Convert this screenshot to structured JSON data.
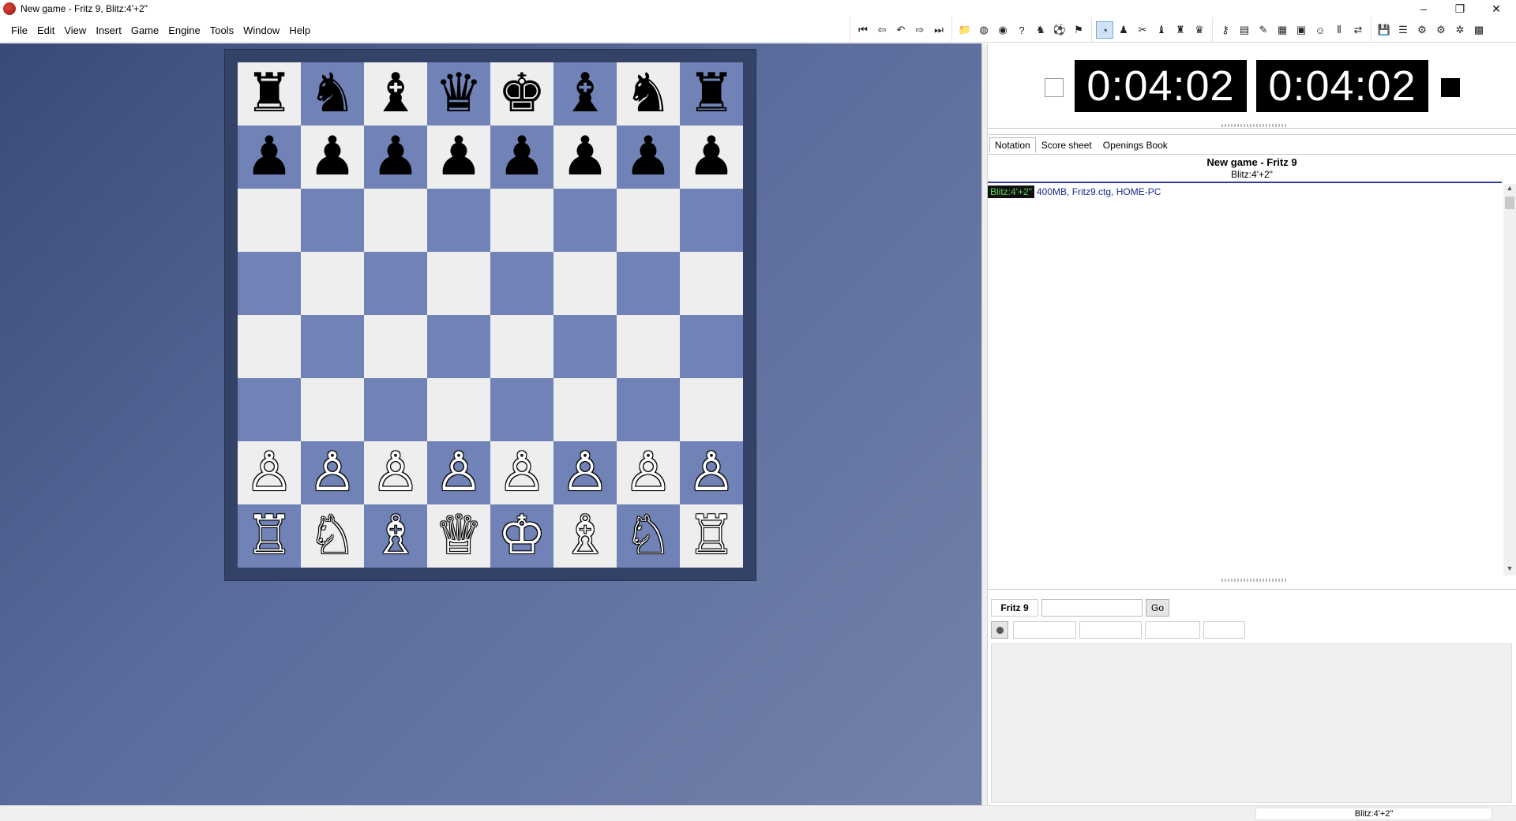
{
  "window": {
    "title": "New game - Fritz 9, Blitz:4'+2\"",
    "minimize": "–",
    "restore": "❐",
    "close": "✕"
  },
  "menu": [
    "File",
    "Edit",
    "View",
    "Insert",
    "Game",
    "Engine",
    "Tools",
    "Window",
    "Help"
  ],
  "toolbar_groups": [
    [
      {
        "name": "first-move-icon",
        "glyph": "⏮"
      },
      {
        "name": "back-icon",
        "glyph": "⇦"
      },
      {
        "name": "undo-move-icon",
        "glyph": "↶"
      },
      {
        "name": "forward-icon",
        "glyph": "⇨"
      },
      {
        "name": "last-move-icon",
        "glyph": "⏭"
      }
    ],
    [
      {
        "name": "open-folder-icon",
        "glyph": "📁"
      },
      {
        "name": "globe-icon",
        "glyph": "◍"
      },
      {
        "name": "coin-icon",
        "glyph": "◉"
      },
      {
        "name": "hint-icon",
        "glyph": "?"
      },
      {
        "name": "chess-piece-icon",
        "glyph": "♞"
      },
      {
        "name": "ball-icon",
        "glyph": "⚽"
      },
      {
        "name": "flag-icon",
        "glyph": "⚑"
      }
    ],
    [
      {
        "name": "clock-icon",
        "glyph": "◔",
        "active": true
      },
      {
        "name": "pawn-icon",
        "glyph": "♟"
      },
      {
        "name": "tool-icon",
        "glyph": "✂"
      },
      {
        "name": "figure-icon",
        "glyph": "♝"
      },
      {
        "name": "pieces-icon",
        "glyph": "♜"
      },
      {
        "name": "red-piece-icon",
        "glyph": "♛"
      }
    ],
    [
      {
        "name": "key-icon",
        "glyph": "⚷"
      },
      {
        "name": "book-icon",
        "glyph": "▤"
      },
      {
        "name": "pen-icon",
        "glyph": "✎"
      },
      {
        "name": "board-icon",
        "glyph": "▦"
      },
      {
        "name": "grid-icon",
        "glyph": "▣"
      },
      {
        "name": "person-icon",
        "glyph": "☺"
      },
      {
        "name": "split-icon",
        "glyph": "⫴"
      },
      {
        "name": "link-icon",
        "glyph": "⇄"
      }
    ],
    [
      {
        "name": "save-icon",
        "glyph": "💾"
      },
      {
        "name": "settings-bars-icon",
        "glyph": "☰"
      },
      {
        "name": "engine-icon",
        "glyph": "⚙"
      },
      {
        "name": "engine-2-icon",
        "glyph": "⚙"
      },
      {
        "name": "analysis-icon",
        "glyph": "✲"
      },
      {
        "name": "window-icon",
        "glyph": "▩"
      }
    ]
  ],
  "board": {
    "ranks": [
      [
        "♜",
        "♞",
        "♝",
        "♛",
        "♚",
        "♝",
        "♞",
        "♜"
      ],
      [
        "♟",
        "♟",
        "♟",
        "♟",
        "♟",
        "♟",
        "♟",
        "♟"
      ],
      [
        "",
        "",
        "",
        "",
        "",
        "",
        "",
        ""
      ],
      [
        "",
        "",
        "",
        "",
        "",
        "",
        "",
        ""
      ],
      [
        "",
        "",
        "",
        "",
        "",
        "",
        "",
        ""
      ],
      [
        "",
        "",
        "",
        "",
        "",
        "",
        "",
        ""
      ],
      [
        "♙",
        "♙",
        "♙",
        "♙",
        "♙",
        "♙",
        "♙",
        "♙"
      ],
      [
        "♖",
        "♘",
        "♗",
        "♕",
        "♔",
        "♗",
        "♘",
        "♖"
      ]
    ],
    "light_color": "#eeeeee",
    "dark_color": "#7082b6"
  },
  "clocks": {
    "white": "0:04:02",
    "black": "0:04:02"
  },
  "notation": {
    "tabs": [
      "Notation",
      "Score sheet",
      "Openings Book"
    ],
    "active_tab": 0,
    "game_title": "New game - Fritz 9",
    "time_control": "Blitz:4'+2\"",
    "time_tag": "Blitz:4'+2\"",
    "info": "400MB, Fritz9.ctg, HOME-PC"
  },
  "engine": {
    "name": "Fritz 9",
    "input_value": "",
    "go_label": "Go"
  },
  "status": {
    "right": "Blitz:4'+2\""
  }
}
